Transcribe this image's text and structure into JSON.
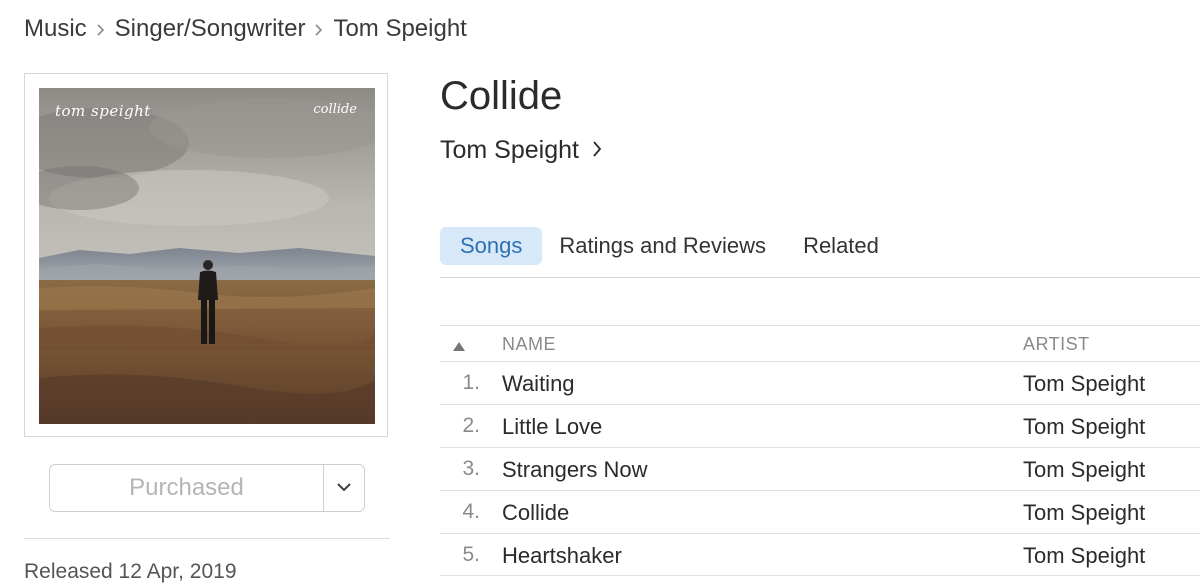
{
  "breadcrumb": {
    "items": [
      "Music",
      "Singer/Songwriter",
      "Tom Speight"
    ]
  },
  "artwork": {
    "text_left": "tom speight",
    "text_right": "collide"
  },
  "album": {
    "title": "Collide",
    "artist": "Tom Speight"
  },
  "purchase": {
    "label": "Purchased"
  },
  "release": {
    "text": "Released 12 Apr, 2019"
  },
  "tabs": [
    {
      "label": "Songs",
      "active": true
    },
    {
      "label": "Ratings and Reviews",
      "active": false
    },
    {
      "label": "Related",
      "active": false
    }
  ],
  "table": {
    "headers": {
      "name": "NAME",
      "artist": "ARTIST"
    },
    "rows": [
      {
        "num": "1.",
        "name": "Waiting",
        "artist": "Tom Speight"
      },
      {
        "num": "2.",
        "name": "Little Love",
        "artist": "Tom Speight"
      },
      {
        "num": "3.",
        "name": "Strangers Now",
        "artist": "Tom Speight"
      },
      {
        "num": "4.",
        "name": "Collide",
        "artist": "Tom Speight"
      },
      {
        "num": "5.",
        "name": "Heartshaker",
        "artist": "Tom Speight"
      }
    ]
  },
  "colors": {
    "active_tab_bg": "#d7e8f8",
    "active_tab_text": "#2f6fb3",
    "muted_text": "#8a8a8a"
  },
  "icons": {
    "breadcrumb_separator": "chevron-right-icon",
    "artist_link": "chevron-right-icon",
    "purchase_dropdown": "chevron-down-icon",
    "sort": "sort-ascending-icon"
  }
}
